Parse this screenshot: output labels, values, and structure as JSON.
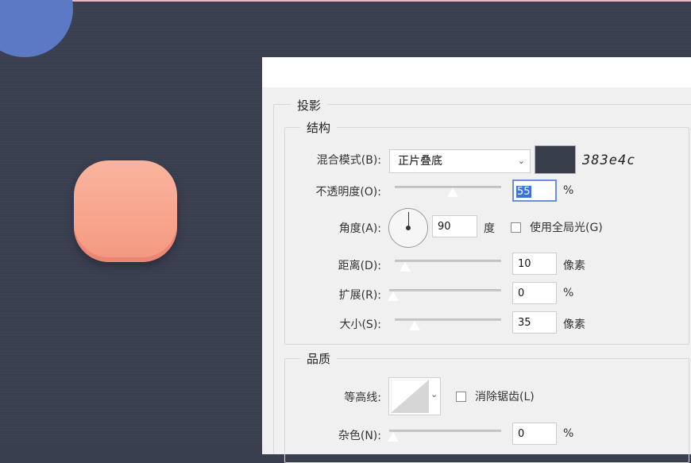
{
  "colors": {
    "canvas_bg": "#3a3f50",
    "top_accent": "#e9b7c3",
    "decor_circle": "#5b79c5",
    "button_sample": "#f8a993",
    "shadow_swatch": "#383e4c",
    "focus": "#3b72d6"
  },
  "dialog": {
    "section_title": "投影",
    "structure": {
      "title": "结构",
      "blend_mode_label": "混合模式(B):",
      "blend_mode_value": "正片叠底",
      "shadow_color_hex": "383e4c",
      "opacity_label": "不透明度(O):",
      "opacity_value": "55",
      "opacity_unit": "%",
      "opacity_slider_fraction": 0.55,
      "angle_label": "角度(A):",
      "angle_value": "90",
      "angle_unit": "度",
      "global_light_label": "使用全局光(G)",
      "global_light_checked": false,
      "distance_label": "距离(D):",
      "distance_value": "10",
      "distance_unit": "像素",
      "distance_slider_fraction": 0.1,
      "spread_label": "扩展(R):",
      "spread_value": "0",
      "spread_unit": "%",
      "spread_slider_fraction": 0.0,
      "size_label": "大小(S):",
      "size_value": "35",
      "size_unit": "像素",
      "size_slider_fraction": 0.19
    },
    "quality": {
      "title": "品质",
      "contour_label": "等高线:",
      "anti_alias_label": "消除锯齿(L)",
      "anti_alias_checked": false,
      "noise_label": "杂色(N):",
      "noise_value": "0",
      "noise_unit": "%",
      "noise_slider_fraction": 0.0
    }
  },
  "icons": {
    "dropdown": "chevron-down-icon",
    "angle_dial": "angle-dial-icon"
  }
}
